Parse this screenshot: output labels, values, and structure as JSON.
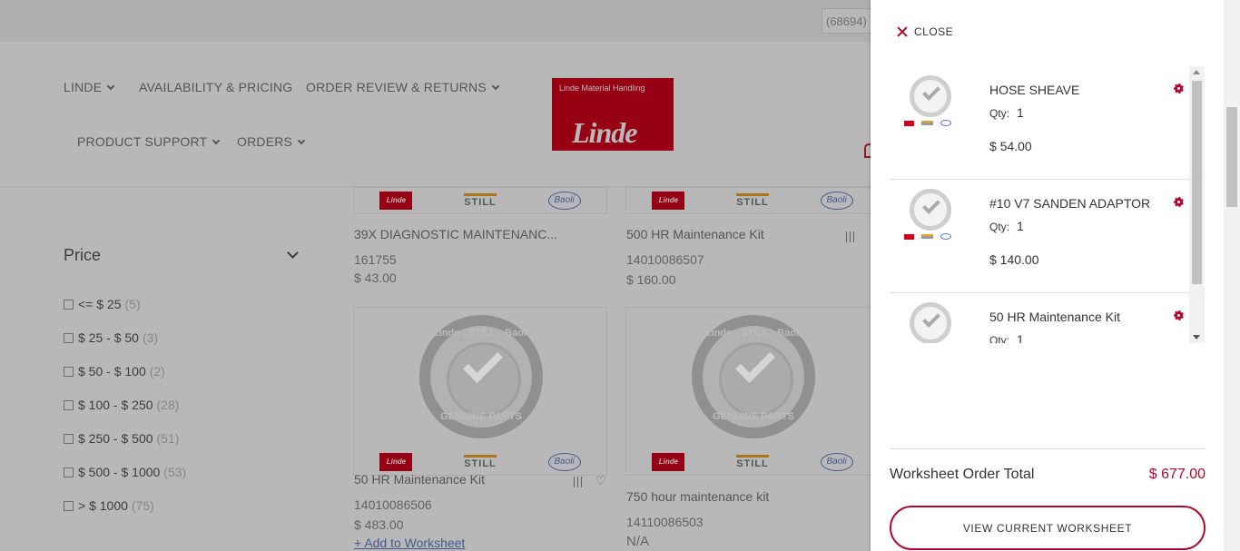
{
  "topbar": {
    "search_value": "(68694)"
  },
  "nav": {
    "items": [
      {
        "label": "LINDE"
      },
      {
        "label": "AVAILABILITY & PRICING"
      },
      {
        "label": "ORDER REVIEW & RETURNS"
      },
      {
        "label": "PRODUCT SUPPORT"
      },
      {
        "label": "ORDERS"
      }
    ],
    "logo": {
      "top_text": "Linde Material Handling",
      "main_text": "Linde"
    }
  },
  "filters": {
    "title": "Price",
    "options": [
      {
        "label": "<= $ 25",
        "count": "(5)"
      },
      {
        "label": "$ 25 - $ 50",
        "count": "(3)"
      },
      {
        "label": "$ 50 - $ 100",
        "count": "(2)"
      },
      {
        "label": "$ 100 - $ 250",
        "count": "(28)"
      },
      {
        "label": "$ 250 - $ 500",
        "count": "(51)"
      },
      {
        "label": "$ 500 - $ 1000",
        "count": "(53)"
      },
      {
        "label": "> $ 1000",
        "count": "(75)"
      }
    ]
  },
  "brands": {
    "linde": "Linde",
    "still": "STILL",
    "baoli": "Baoli"
  },
  "seal": {
    "top": "Linde · STILL · Baoli",
    "bottom": "GENUINE PARTS"
  },
  "products": [
    {
      "name": "39X DIAGNOSTIC MAINTENANC...",
      "sku": "161755",
      "price": "$ 43.00"
    },
    {
      "name": "500 HR Maintenance Kit",
      "sku": "14010086507",
      "price": "$ 160.00"
    },
    {
      "name": "50 HR Maintenance Kit",
      "sku": "14010086506",
      "price": "$ 483.00",
      "link": "+ Add to Worksheet"
    },
    {
      "name": "750 hour maintenance kit",
      "sku": "14110086503",
      "price": "N/A"
    }
  ],
  "drawer": {
    "close_label": "CLOSE",
    "qty_label": "Qty:",
    "items": [
      {
        "name": "HOSE SHEAVE",
        "qty": "1",
        "price": "$ 54.00"
      },
      {
        "name": "#10 V7 SANDEN ADAPTOR",
        "qty": "1",
        "price": "$ 140.00"
      },
      {
        "name": "50 HR Maintenance Kit",
        "qty": "1",
        "price": ""
      }
    ],
    "total_label": "Worksheet Order Total",
    "total_value": "$ 677.00",
    "view_button": "VIEW CURRENT WORKSHEET"
  },
  "colors": {
    "accent": "#b3072b",
    "brand_red": "#d0021b",
    "link": "#5a7ec6"
  }
}
